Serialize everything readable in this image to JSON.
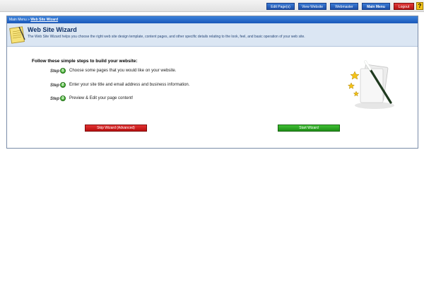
{
  "topnav": {
    "edit_pages": "Edit Page(s)",
    "view_website": "View Website",
    "webmaster": "Webmaster",
    "main_menu": "Main Menu",
    "logout": "Logout",
    "help": "?"
  },
  "breadcrumb": {
    "root": "Main Menu",
    "separator": "»",
    "current": "Web Site Wizard"
  },
  "header": {
    "title": "Web Site Wizard",
    "description": "The Web Site Wizard helps you choose the right web site design template, content pages, and other specific details relating to the look, feel, and basic operation of your web site."
  },
  "steps": {
    "heading": "Follow these simple steps to build your website:",
    "label": "Step",
    "items": [
      {
        "num": "1",
        "text": "Choose some pages that you would like on your website."
      },
      {
        "num": "2",
        "text": "Enter your site title and email address and business information."
      },
      {
        "num": "3",
        "text": "Preview & Edit your page content!"
      }
    ]
  },
  "actions": {
    "skip": "Skip Wizard (Advanced)",
    "start": "Start Wizard"
  },
  "colors": {
    "accent_blue": "#1d4fa8",
    "danger_red": "#b81010",
    "success_green": "#1f8f17"
  }
}
